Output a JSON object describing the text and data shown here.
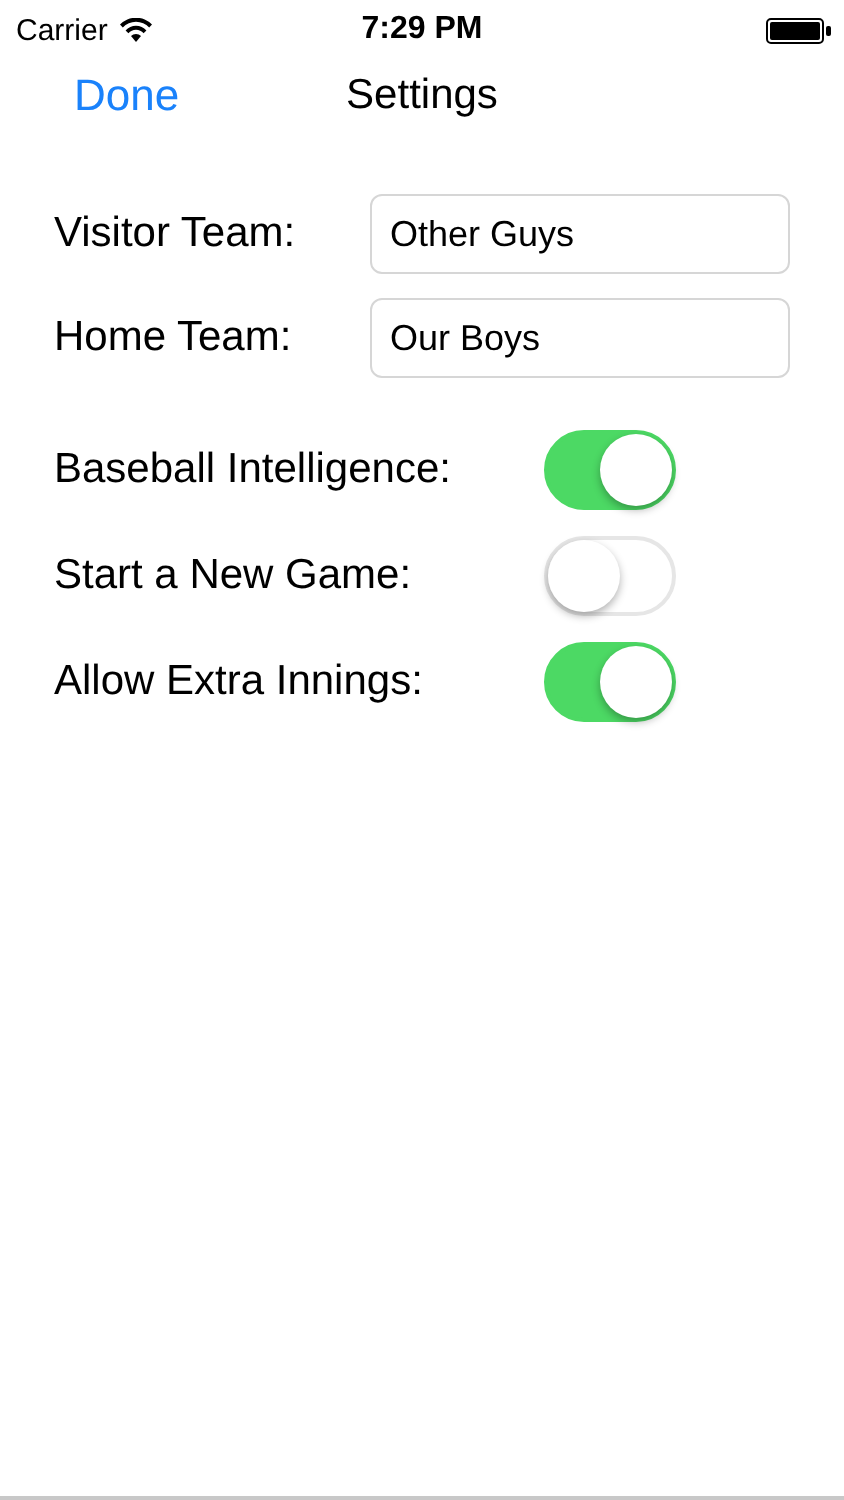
{
  "status_bar": {
    "carrier": "Carrier",
    "time": "7:29 PM"
  },
  "nav": {
    "back": "Done",
    "title": "Settings"
  },
  "fields": [
    {
      "label": "Visitor Team:",
      "value": "Other Guys"
    },
    {
      "label": "Home Team:",
      "value": "Our Boys"
    }
  ],
  "switches": [
    {
      "label": "Baseball Intelligence:",
      "on": true
    },
    {
      "label": "Start a New Game:",
      "on": false
    },
    {
      "label": "Allow Extra Innings:",
      "on": true
    }
  ]
}
